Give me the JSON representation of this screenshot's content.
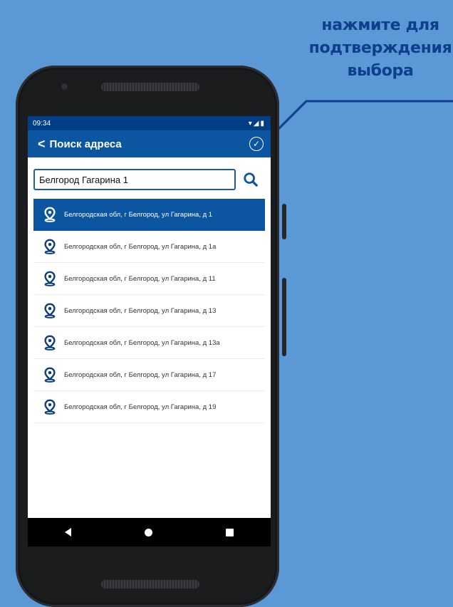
{
  "callout": {
    "lines": [
      "нажмите для",
      "подтверждения",
      "выбора"
    ]
  },
  "status": {
    "time": "09:34",
    "icons": "▾◢▮"
  },
  "appbar": {
    "back_glyph": "<",
    "title": "Поиск адреса",
    "confirm_glyph": "✓"
  },
  "search": {
    "value": "Белгород Гагарина 1"
  },
  "results": [
    "Белгородская обл, г Белгород, ул Гагарина, д 1",
    "Белгородская обл, г Белгород, ул Гагарина, д 1а",
    "Белгородская обл, г Белгород, ул Гагарина, д 11",
    "Белгородская обл, г Белгород, ул Гагарина, д 13",
    "Белгородская обл, г Белгород, ул Гагарина, д 13а",
    "Белгородская обл, г Белгород, ул Гагарина, д 17",
    "Белгородская обл, г Белгород, ул Гагарина, д 19"
  ],
  "colors": {
    "accent": "#0b55a1",
    "status_bar": "#003f88",
    "background": "#5b98d6",
    "callout_text": "#0f3f8c"
  },
  "icons": {
    "result": "location-pin-icon",
    "search": "search-icon",
    "confirm": "check-circle-icon"
  }
}
